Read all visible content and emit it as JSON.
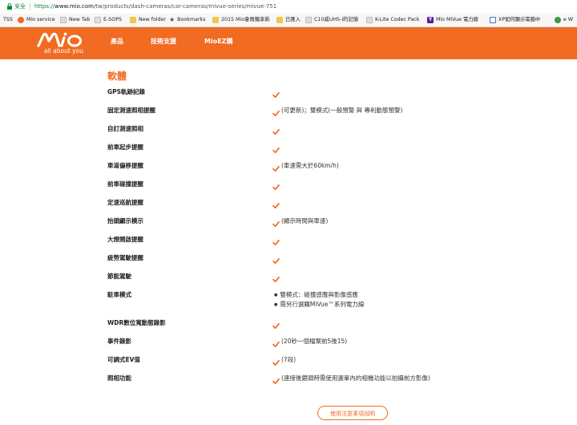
{
  "browser": {
    "security_label": "安全",
    "url_protocol": "https://",
    "url_host": "www.mio.com",
    "url_path": "/tw/products/dash-cameras/car-cameras/mivue-series/mivue-751"
  },
  "bookmarks": [
    {
      "label": "TSS",
      "icon": "none-icon"
    },
    {
      "label": "Mio service",
      "icon": "mio-icon"
    },
    {
      "label": "New Tab",
      "icon": "page-icon"
    },
    {
      "label": "E-SOPS",
      "icon": "page-icon"
    },
    {
      "label": "New folder",
      "icon": "folder-icon"
    },
    {
      "label": "Bookmarks",
      "icon": "star-icon"
    },
    {
      "label": "2015 Mio會員獨享新",
      "icon": "folder-icon"
    },
    {
      "label": "已匯入",
      "icon": "folder-icon"
    },
    {
      "label": "C10威UHS-I的記憶",
      "icon": "page-icon"
    },
    {
      "label": "K-Lite Codec Pack",
      "icon": "page-icon"
    },
    {
      "label": "Mio MiVue 電力線",
      "icon": "yahoo-icon"
    },
    {
      "label": "XP如何顯示電腦中",
      "icon": "xp-icon"
    },
    {
      "label": "e W",
      "icon": "green-icon"
    }
  ],
  "header": {
    "logo_text": "mio",
    "tagline": "all about you",
    "nav": [
      "產品",
      "技術支援",
      "MioEZ購"
    ]
  },
  "section_title": "軟體",
  "specs": [
    {
      "label": "GPS軌跡記錄",
      "check": true,
      "note": ""
    },
    {
      "label": "固定測速照相提醒",
      "check": true,
      "note": "(可更新)；雙模式(一般預警 與 專利動態預警)"
    },
    {
      "label": "自訂測速照相",
      "check": true,
      "note": ""
    },
    {
      "label": "前車起步提醒",
      "check": true,
      "note": ""
    },
    {
      "label": "車道偏移提醒",
      "check": true,
      "note": "(車速需大於60km/h)"
    },
    {
      "label": "前車碰撞提醒",
      "check": true,
      "note": ""
    },
    {
      "label": "定速巡航提醒",
      "check": true,
      "note": ""
    },
    {
      "label": "抬頭顯示模示",
      "check": true,
      "note": "(顯示時間與車速)"
    },
    {
      "label": "大燈開啟提醒",
      "check": true,
      "note": ""
    },
    {
      "label": "疲勞駕駛提醒",
      "check": true,
      "note": ""
    },
    {
      "label": "節能駕駛",
      "check": true,
      "note": ""
    },
    {
      "label": "駐車模式",
      "check": false,
      "bullets": [
        "雙模式：碰撞感應與影像感應",
        "需另行選購MiVue™系列電力線"
      ]
    },
    {
      "label": "WDR數位寬動態錄影",
      "check": true,
      "note": ""
    },
    {
      "label": "事件錄影",
      "check": true,
      "note": "(20秒一個檔案前5後15)"
    },
    {
      "label": "可調式EV值",
      "check": true,
      "note": "(7段)"
    },
    {
      "label": "照相功能",
      "check": true,
      "note": "(連接後鏡頭時需使用選單內的相機功能以拍攝前方影像)"
    }
  ],
  "notice_button": "使用注意事項說明",
  "colors": {
    "brand": "#f26b22"
  }
}
